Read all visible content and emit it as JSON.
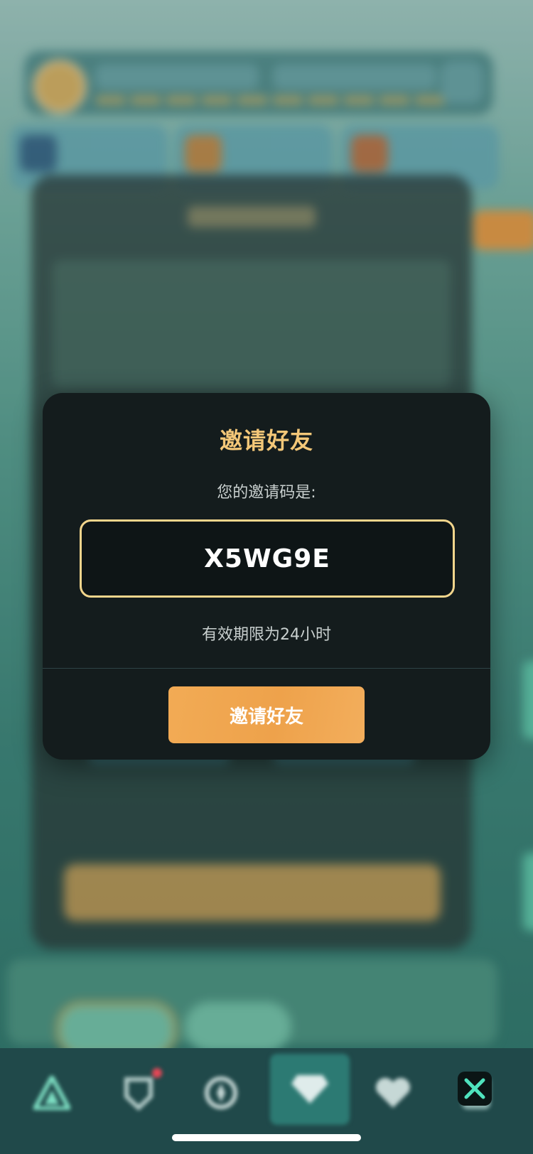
{
  "modal": {
    "title": "邀请好友",
    "code_label": "您的邀请码是:",
    "invite_code": "X5WG9E",
    "validity_text": "有效期限为24小时",
    "invite_button_label": "邀请好友"
  },
  "colors": {
    "modal_bg": "#141c1d",
    "title_gold": "#f3c778",
    "code_border": "#f2d58c",
    "button_orange": "#f2ab55",
    "close_x": "#4fe3be"
  },
  "bottom_nav": {
    "items": [
      {
        "icon": "triangle-logo-icon"
      },
      {
        "icon": "badge-icon",
        "has_notification": true
      },
      {
        "icon": "compass-icon"
      },
      {
        "icon": "diamond-icon",
        "active": true
      },
      {
        "icon": "heart-icon"
      }
    ]
  },
  "close_icon": "close-icon"
}
